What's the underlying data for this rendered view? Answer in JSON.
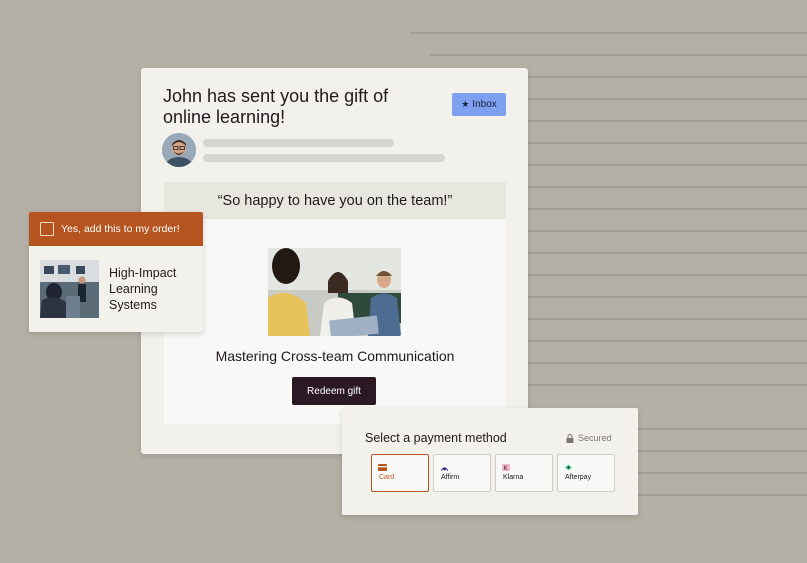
{
  "email": {
    "title": "John has sent you the gift of online learning!",
    "inbox_label": "Inbox",
    "quote": "“So happy to have you on the team!”",
    "course_title": "Mastering Cross-team Communication",
    "redeem_label": "Redeem gift"
  },
  "upsell": {
    "checkbox_label": "Yes, add this to my order!",
    "course_title": "High-Impact Learning Systems"
  },
  "payment": {
    "title": "Select a payment method",
    "secured_label": "Secured",
    "selected": "Card",
    "options": [
      {
        "label": "Card",
        "icon": "card-icon"
      },
      {
        "label": "Affirm",
        "icon": "affirm-icon"
      },
      {
        "label": "Klarna",
        "icon": "klarna-icon"
      },
      {
        "label": "Afterpay",
        "icon": "afterpay-icon"
      }
    ]
  },
  "colors": {
    "background": "#b4b0a5",
    "accent": "#b5541f",
    "inbox_badge": "#7ea0f0",
    "button_dark": "#2b1a24"
  }
}
